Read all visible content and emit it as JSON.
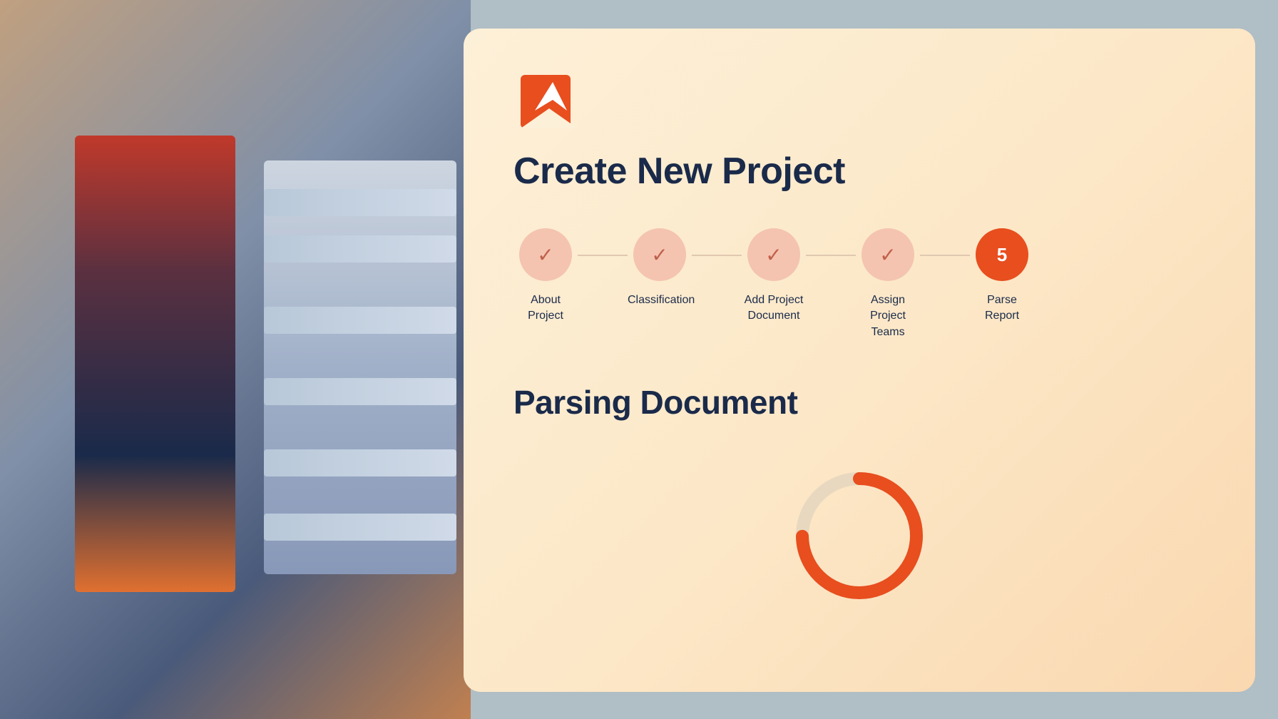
{
  "app": {
    "title": "Create New Project"
  },
  "stepper": {
    "steps": [
      {
        "id": 1,
        "label": "About Project",
        "completed": true,
        "active": false
      },
      {
        "id": 2,
        "label": "Classification",
        "completed": true,
        "active": false
      },
      {
        "id": 3,
        "label": "Add Project Document",
        "completed": true,
        "active": false
      },
      {
        "id": 4,
        "label": "Assign Project Teams",
        "completed": true,
        "active": false
      },
      {
        "id": 5,
        "label": "Parse Report",
        "completed": false,
        "active": true
      }
    ]
  },
  "section": {
    "title": "Parsing Document"
  },
  "progress": {
    "value": 75,
    "circumference": 502,
    "offset": 126
  },
  "colors": {
    "accent": "#e84e1e",
    "dark": "#1a2a4a",
    "step_completed_bg": "#f4c4b0",
    "step_active_bg": "#e84e1e",
    "connector": "#e0c8b0"
  }
}
